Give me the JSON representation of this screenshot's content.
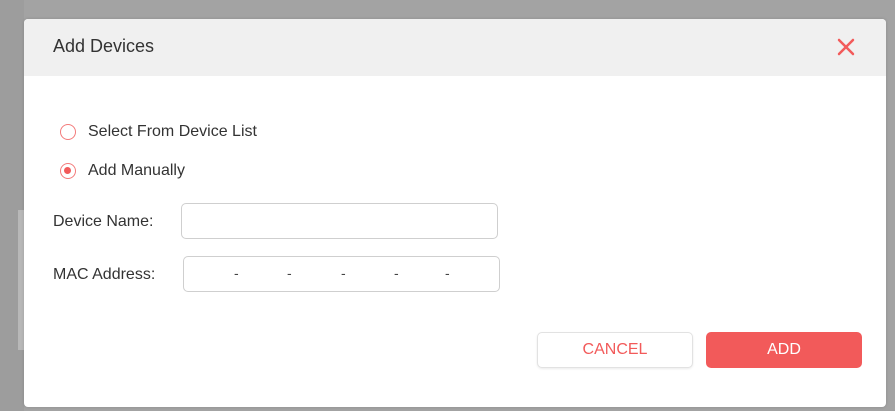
{
  "dialog": {
    "title": "Add Devices",
    "close_icon": "close-icon",
    "close_color": "#f25a5a",
    "header_bg": "#f0f0f0"
  },
  "mode_options": [
    {
      "label": "Select From Device List",
      "checked": false
    },
    {
      "label": "Add Manually",
      "checked": true
    }
  ],
  "form": {
    "device_name_label": "Device Name:",
    "device_name_value": "",
    "mac_address_label": "MAC Address:",
    "mac_separator": "-",
    "mac_segments": [
      "",
      "",
      "",
      "",
      "",
      ""
    ]
  },
  "buttons": {
    "cancel_label": "CANCEL",
    "add_label": "ADD"
  },
  "colors": {
    "accent": "#f25a5a",
    "text": "#333333",
    "border": "#cfcfcf"
  }
}
